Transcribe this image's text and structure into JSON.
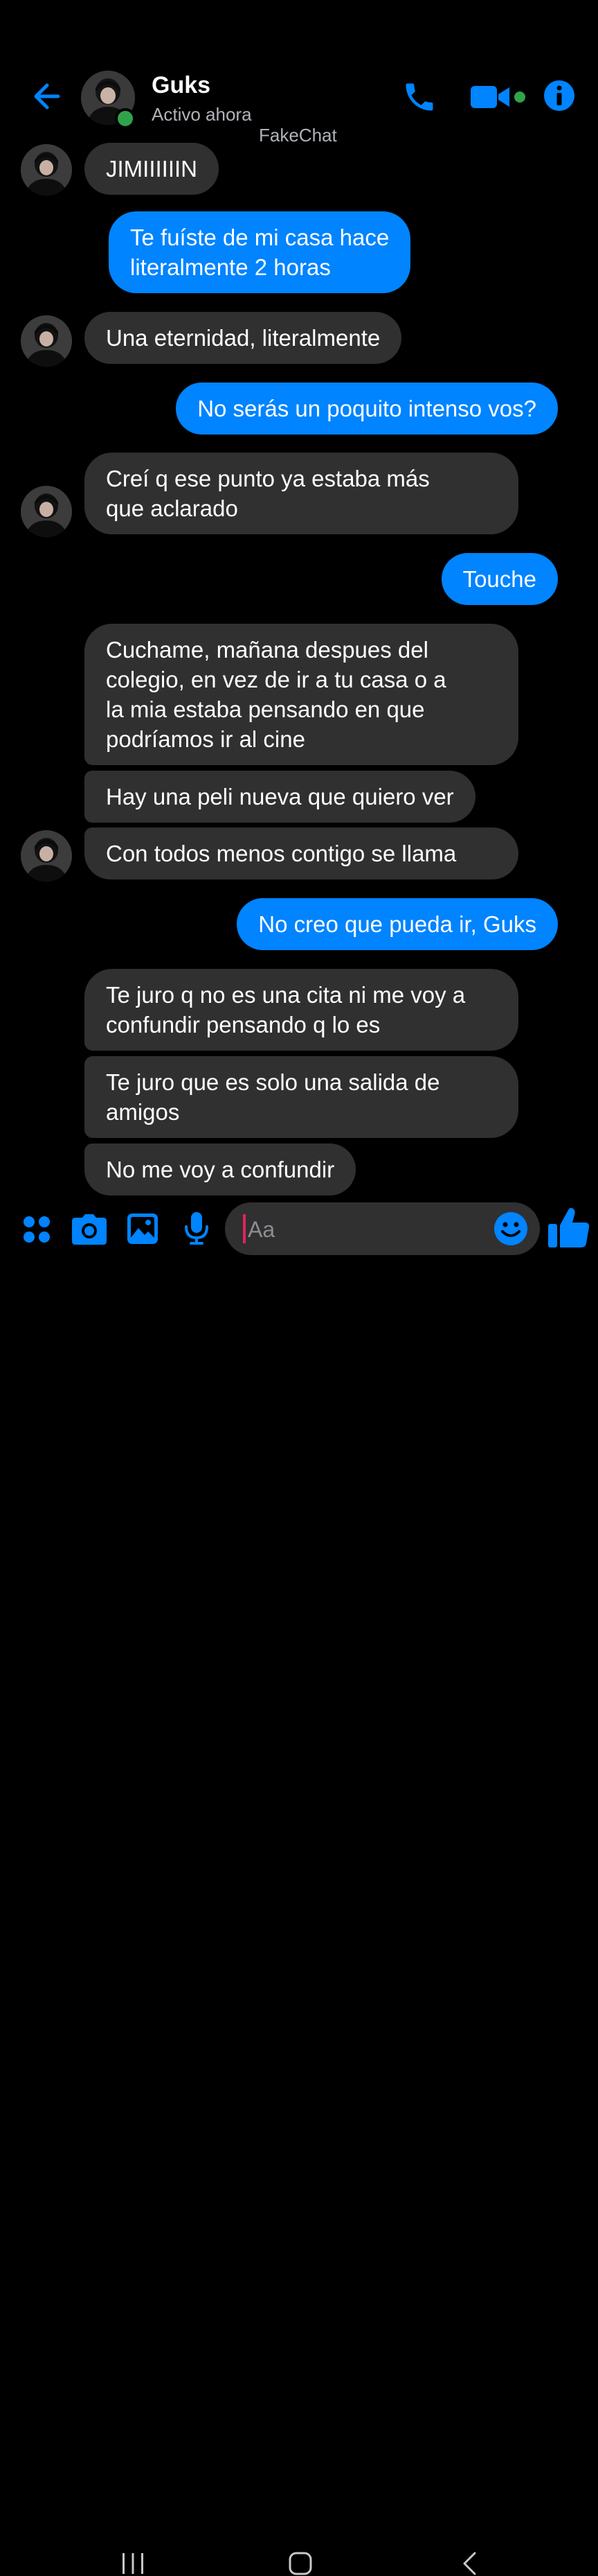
{
  "header": {
    "contact_name": "Guks",
    "status": "Activo ahora",
    "watermark": "FakeChat",
    "accent": "#0084ff",
    "online_color": "#31a24c",
    "icons": [
      "back-arrow-icon",
      "phone-icon",
      "video-camera-icon",
      "info-icon"
    ]
  },
  "messages": [
    {
      "side": "in",
      "text": "JIMIIIIIIN"
    },
    {
      "side": "out",
      "text": "Te fuíste de mi casa hace\nliteralmente 2 horas"
    },
    {
      "side": "in",
      "text": "Una eternidad, literalmente"
    },
    {
      "side": "out",
      "text": "No serás un poquito intenso vos?"
    },
    {
      "side": "in",
      "text": "Creí q ese punto ya estaba más\nque aclarado"
    },
    {
      "side": "out",
      "text": "Touche"
    },
    {
      "side": "in",
      "text": "Cuchame, mañana despues del\ncolegio, en vez de ir a tu casa o a\nla mia estaba pensando en que\npodríamos ir al cine"
    },
    {
      "side": "in",
      "text": "Hay una peli nueva que quiero ver"
    },
    {
      "side": "in",
      "text": "Con todos menos contigo se llama"
    },
    {
      "side": "out",
      "text": "No creo que pueda ir, Guks"
    },
    {
      "side": "in",
      "text": "Te juro q no es una cita ni me voy a\nconfundir pensando q lo es"
    },
    {
      "side": "in",
      "text": "Te juro que es solo una salida de\namigos"
    },
    {
      "side": "in",
      "text": "No me voy a confundir"
    }
  ],
  "composer": {
    "placeholder": "Aa",
    "icons": [
      "apps-grid-icon",
      "camera-icon",
      "gallery-icon",
      "microphone-icon",
      "emoji-icon",
      "thumbs-up-icon"
    ]
  },
  "system_nav": {
    "icons": [
      "recent-apps-icon",
      "home-icon",
      "back-nav-icon"
    ]
  }
}
